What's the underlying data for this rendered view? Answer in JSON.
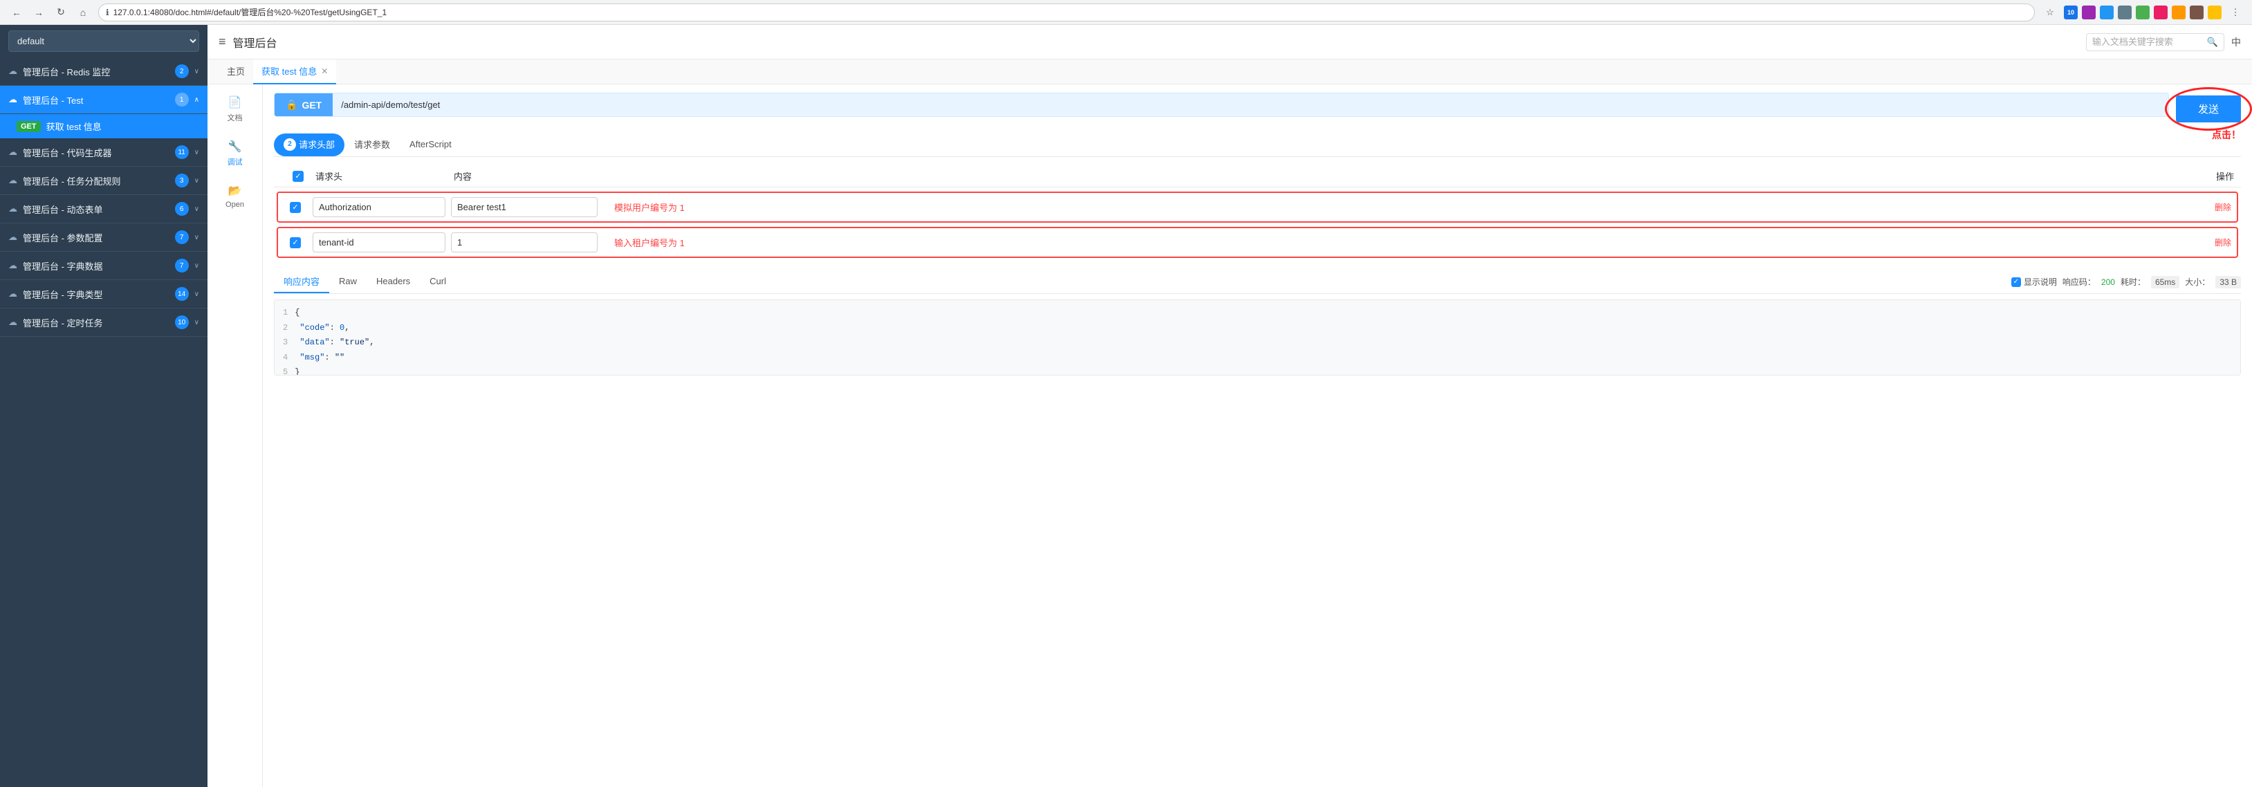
{
  "browser": {
    "url": "127.0.0.1:48080/doc.html#/default/管理后台%20-%20Test/getUsingGET_1",
    "back_label": "←",
    "forward_label": "→",
    "reload_label": "↻",
    "home_label": "⌂",
    "ext_badge": "10"
  },
  "sidebar": {
    "select_value": "default",
    "items": [
      {
        "id": "redis",
        "icon": "☁",
        "label": "管理后台 - Redis 监控",
        "badge": "2",
        "chevron": "∨"
      },
      {
        "id": "test",
        "icon": "☁",
        "label": "管理后台 - Test",
        "badge": "1",
        "chevron": "∧",
        "active": true
      },
      {
        "id": "codegen",
        "icon": "☁",
        "label": "管理后台 - 代码生成器",
        "badge": "11",
        "chevron": "∨"
      },
      {
        "id": "taskrules",
        "icon": "☁",
        "label": "管理后台 - 任务分配规则",
        "badge": "3",
        "chevron": "∨"
      },
      {
        "id": "dynamicform",
        "icon": "☁",
        "label": "管理后台 - 动态表单",
        "badge": "6",
        "chevron": "∨"
      },
      {
        "id": "params",
        "icon": "☁",
        "label": "管理后台 - 参数配置",
        "badge": "7",
        "chevron": "∨"
      },
      {
        "id": "dictdata",
        "icon": "☁",
        "label": "管理后台 - 字典数据",
        "badge": "7",
        "chevron": "∨"
      },
      {
        "id": "dicttype",
        "icon": "☁",
        "label": "管理后台 - 字典类型",
        "badge": "14",
        "chevron": "∨"
      },
      {
        "id": "schedtask",
        "icon": "☁",
        "label": "管理后台 - 定时任务",
        "badge": "10",
        "chevron": "∨"
      }
    ],
    "subitem": {
      "method": "GET",
      "label": "获取 test 信息"
    }
  },
  "header": {
    "icon": "≡",
    "title": "管理后台",
    "search_placeholder": "输入文档关键字搜索",
    "search_icon": "🔍",
    "lang_label": "中"
  },
  "tabs": [
    {
      "id": "home",
      "label": "主页",
      "closable": false,
      "active": false
    },
    {
      "id": "test-info",
      "label": "获取 test 信息",
      "closable": true,
      "active": true
    }
  ],
  "left_panel": [
    {
      "id": "doc",
      "icon": "📄",
      "label": "文档",
      "active": false
    },
    {
      "id": "debug",
      "icon": "🔧",
      "label": "调试",
      "active": true
    },
    {
      "id": "open",
      "icon": "📂",
      "label": "Open",
      "active": false
    }
  ],
  "api": {
    "method": "GET",
    "method_icon": "🔒",
    "url": "/admin-api/demo/test/get",
    "send_label": "发送"
  },
  "sub_tabs": [
    {
      "id": "request-headers",
      "label": "请求头部",
      "badge": "2",
      "active": true
    },
    {
      "id": "request-params",
      "label": "请求参数",
      "active": false
    },
    {
      "id": "afterscript",
      "label": "AfterScript",
      "active": false
    }
  ],
  "headers_table": {
    "col_check": "",
    "col_key": "请求头",
    "col_value": "内容",
    "col_action": "操作",
    "rows": [
      {
        "id": "auth-row",
        "checked": true,
        "key": "Authorization",
        "value": "Bearer test1",
        "hint": "模拟用户编号为 1",
        "delete_label": "删除",
        "highlighted": true
      },
      {
        "id": "tenant-row",
        "checked": true,
        "key": "tenant-id",
        "value": "1",
        "hint": "输入租户编号为 1",
        "delete_label": "删除",
        "highlighted": true
      }
    ]
  },
  "response": {
    "tabs": [
      {
        "id": "body",
        "label": "响应内容",
        "active": true
      },
      {
        "id": "raw",
        "label": "Raw",
        "active": false
      },
      {
        "id": "headers",
        "label": "Headers",
        "active": false
      },
      {
        "id": "curl",
        "label": "Curl",
        "active": false
      }
    ],
    "show_desc_label": "显示说明",
    "status_code": "200",
    "time": "65ms",
    "size": "33 B",
    "status_label": "响应码：",
    "time_label": "耗时：",
    "size_label": "大小：",
    "body_lines": [
      {
        "num": "1",
        "text": "{"
      },
      {
        "num": "2",
        "text": "  \"code\": 0,"
      },
      {
        "num": "3",
        "text": "  \"data\": \"true\","
      },
      {
        "num": "4",
        "text": "  \"msg\": \"\""
      },
      {
        "num": "5",
        "text": "}"
      }
    ]
  },
  "annotations": {
    "click_label": "点击！"
  }
}
